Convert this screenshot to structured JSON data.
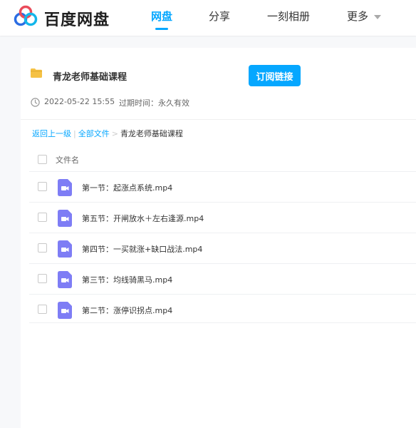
{
  "brand": {
    "name": "百度网盘"
  },
  "nav": {
    "items": [
      {
        "label": "网盘",
        "active": true
      },
      {
        "label": "分享",
        "active": false
      },
      {
        "label": "一刻相册",
        "active": false
      },
      {
        "label": "更多",
        "active": false
      }
    ]
  },
  "share": {
    "title": "青龙老师基础课程",
    "subscribe_label": "订阅链接",
    "date": "2022-05-22 15:55",
    "expire_label": "过期时间：",
    "expire_value": "永久有效"
  },
  "breadcrumb": {
    "back": "返回上一级",
    "sep1": "|",
    "all_files": "全部文件",
    "sep2": ">",
    "current": "青龙老师基础课程"
  },
  "list": {
    "column_name": "文件名",
    "files": [
      {
        "name": "第一节：起涨点系统.mp4"
      },
      {
        "name": "第五节：开闸放水＋左右逢源.mp4"
      },
      {
        "name": "第四节：一买就涨+缺口战法.mp4"
      },
      {
        "name": "第三节：均线骑黑马.mp4"
      },
      {
        "name": "第二节：涨停识拐点.mp4"
      }
    ]
  },
  "colors": {
    "accent": "#06a7ff",
    "folder": "#f5c144",
    "video": "#7e7df5"
  }
}
